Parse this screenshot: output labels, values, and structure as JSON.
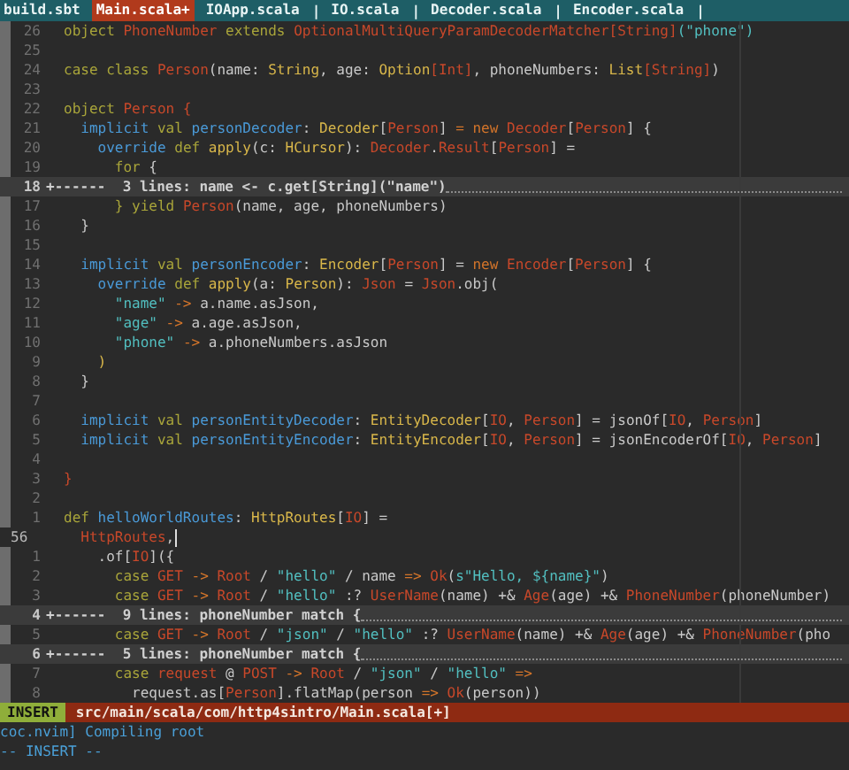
{
  "tabs": [
    {
      "label": "build.sbt",
      "selected": false
    },
    {
      "label": "Main.scala+",
      "selected": true
    },
    {
      "label": "IOApp.scala",
      "selected": false,
      "separator": "|"
    },
    {
      "label": "IO.scala",
      "selected": false,
      "separator": "|"
    },
    {
      "label": "Decoder.scala",
      "selected": false,
      "separator": "|"
    },
    {
      "label": "Encoder.scala",
      "selected": false,
      "separator": "|"
    }
  ],
  "lines": [
    {
      "kind": "code",
      "number": "26",
      "current": false,
      "tokens": [
        {
          "kind": "keyword",
          "text": "object "
        },
        {
          "kind": "name",
          "text": "PhoneNumber"
        },
        {
          "kind": "keyword",
          "text": " extends "
        },
        {
          "kind": "name",
          "text": "OptionalMultiQueryParamDecoderMatcher[String]"
        },
        {
          "kind": "string",
          "text": "(\"phone\")"
        }
      ]
    },
    {
      "kind": "code",
      "number": "25",
      "current": false
    },
    {
      "kind": "code",
      "number": "24",
      "current": false,
      "tokens": [
        {
          "kind": "keyword",
          "text": "case class "
        },
        {
          "kind": "name",
          "text": "Person"
        },
        {
          "kind": "plain",
          "text": "(name: "
        },
        {
          "kind": "type",
          "text": "String"
        },
        {
          "kind": "plain",
          "text": ", age: "
        },
        {
          "kind": "type",
          "text": "Option"
        },
        {
          "kind": "name",
          "text": "[Int]"
        },
        {
          "kind": "plain",
          "text": ", phoneNumbers: "
        },
        {
          "kind": "type",
          "text": "List"
        },
        {
          "kind": "name",
          "text": "[String]"
        },
        {
          "kind": "plain",
          "text": ")"
        }
      ]
    },
    {
      "kind": "code",
      "number": "23",
      "current": false
    },
    {
      "kind": "code",
      "number": "22",
      "current": false,
      "tokens": [
        {
          "kind": "keyword",
          "text": "object "
        },
        {
          "kind": "name",
          "text": "Person {"
        }
      ]
    },
    {
      "kind": "code",
      "number": "21",
      "current": false,
      "tokens": [
        {
          "kind": "modifier",
          "text": "  implicit "
        },
        {
          "kind": "keyword",
          "text": "val "
        },
        {
          "kind": "modifier",
          "text": "personDecoder"
        },
        {
          "kind": "plain",
          "text": ": "
        },
        {
          "kind": "type",
          "text": "Decoder"
        },
        {
          "kind": "plain",
          "text": "["
        },
        {
          "kind": "name",
          "text": "Person"
        },
        {
          "kind": "plain",
          "text": "] "
        },
        {
          "kind": "operator",
          "text": "= new "
        },
        {
          "kind": "name",
          "text": "Decoder"
        },
        {
          "kind": "plain",
          "text": "["
        },
        {
          "kind": "name",
          "text": "Person"
        },
        {
          "kind": "plain",
          "text": "] {"
        }
      ]
    },
    {
      "kind": "code",
      "number": "20",
      "current": false,
      "tokens": [
        {
          "kind": "modifier",
          "text": "    override "
        },
        {
          "kind": "keyword",
          "text": "def "
        },
        {
          "kind": "type",
          "text": "apply"
        },
        {
          "kind": "plain",
          "text": "(c: "
        },
        {
          "kind": "type",
          "text": "HCursor"
        },
        {
          "kind": "plain",
          "text": "): "
        },
        {
          "kind": "name",
          "text": "Decoder"
        },
        {
          "kind": "plain",
          "text": "."
        },
        {
          "kind": "name",
          "text": "Result"
        },
        {
          "kind": "plain",
          "text": "["
        },
        {
          "kind": "name",
          "text": "Person"
        },
        {
          "kind": "plain",
          "text": "] ="
        }
      ]
    },
    {
      "kind": "code",
      "number": "19",
      "current": false,
      "tokens": [
        {
          "kind": "keyword",
          "text": "      for"
        },
        {
          "kind": "plain",
          "text": " {"
        }
      ]
    },
    {
      "kind": "fold",
      "number": "18",
      "current": false,
      "text": "+------  3 lines: name <- c.get[String](\"name\")"
    },
    {
      "kind": "code",
      "number": "17",
      "current": false,
      "tokens": [
        {
          "kind": "keyword",
          "text": "      } yield "
        },
        {
          "kind": "name",
          "text": "Person"
        },
        {
          "kind": "plain",
          "text": "(name, age, phoneNumbers)"
        }
      ]
    },
    {
      "kind": "code",
      "number": "16",
      "current": false,
      "tokens": [
        {
          "kind": "plain",
          "text": "  }"
        }
      ]
    },
    {
      "kind": "code",
      "number": "15",
      "current": false
    },
    {
      "kind": "code",
      "number": "14",
      "current": false,
      "tokens": [
        {
          "kind": "modifier",
          "text": "  implicit "
        },
        {
          "kind": "keyword",
          "text": "val "
        },
        {
          "kind": "modifier",
          "text": "personEncoder"
        },
        {
          "kind": "plain",
          "text": ": "
        },
        {
          "kind": "type",
          "text": "Encoder"
        },
        {
          "kind": "plain",
          "text": "["
        },
        {
          "kind": "name",
          "text": "Person"
        },
        {
          "kind": "plain",
          "text": "] = "
        },
        {
          "kind": "operator",
          "text": "new "
        },
        {
          "kind": "name",
          "text": "Encoder"
        },
        {
          "kind": "plain",
          "text": "["
        },
        {
          "kind": "name",
          "text": "Person"
        },
        {
          "kind": "plain",
          "text": "] {"
        }
      ]
    },
    {
      "kind": "code",
      "number": "13",
      "current": false,
      "tokens": [
        {
          "kind": "modifier",
          "text": "    override "
        },
        {
          "kind": "keyword",
          "text": "def "
        },
        {
          "kind": "type",
          "text": "apply"
        },
        {
          "kind": "plain",
          "text": "(a: "
        },
        {
          "kind": "type",
          "text": "Person"
        },
        {
          "kind": "plain",
          "text": "): "
        },
        {
          "kind": "name",
          "text": "Json"
        },
        {
          "kind": "plain",
          "text": " = "
        },
        {
          "kind": "name",
          "text": "Json"
        },
        {
          "kind": "plain",
          "text": ".obj("
        }
      ]
    },
    {
      "kind": "code",
      "number": "12",
      "current": false,
      "tokens": [
        {
          "kind": "string",
          "text": "      \"name\""
        },
        {
          "kind": "operator",
          "text": " -> "
        },
        {
          "kind": "plain",
          "text": "a.name.asJson,"
        }
      ]
    },
    {
      "kind": "code",
      "number": "11",
      "current": false,
      "tokens": [
        {
          "kind": "string",
          "text": "      \"age\""
        },
        {
          "kind": "operator",
          "text": " -> "
        },
        {
          "kind": "plain",
          "text": "a.age.asJson,"
        }
      ]
    },
    {
      "kind": "code",
      "number": "10",
      "current": false,
      "tokens": [
        {
          "kind": "string",
          "text": "      \"phone\""
        },
        {
          "kind": "operator",
          "text": " -> "
        },
        {
          "kind": "plain",
          "text": "a.phoneNumbers.asJson"
        }
      ]
    },
    {
      "kind": "code",
      "number": "9",
      "current": false,
      "tokens": [
        {
          "kind": "type",
          "text": "    )"
        }
      ]
    },
    {
      "kind": "code",
      "number": "8",
      "current": false,
      "tokens": [
        {
          "kind": "plain",
          "text": "  }"
        }
      ]
    },
    {
      "kind": "code",
      "number": "7",
      "current": false
    },
    {
      "kind": "code",
      "number": "6",
      "current": false,
      "tokens": [
        {
          "kind": "modifier",
          "text": "  implicit "
        },
        {
          "kind": "keyword",
          "text": "val "
        },
        {
          "kind": "modifier",
          "text": "personEntityDecoder"
        },
        {
          "kind": "plain",
          "text": ": "
        },
        {
          "kind": "type",
          "text": "EntityDecoder"
        },
        {
          "kind": "plain",
          "text": "["
        },
        {
          "kind": "name",
          "text": "IO"
        },
        {
          "kind": "plain",
          "text": ", "
        },
        {
          "kind": "name",
          "text": "Person"
        },
        {
          "kind": "plain",
          "text": "] = jsonOf["
        },
        {
          "kind": "name",
          "text": "IO"
        },
        {
          "kind": "plain",
          "text": ", "
        },
        {
          "kind": "name",
          "text": "Person"
        },
        {
          "kind": "plain",
          "text": "]"
        }
      ]
    },
    {
      "kind": "code",
      "number": "5",
      "current": false,
      "tokens": [
        {
          "kind": "modifier",
          "text": "  implicit "
        },
        {
          "kind": "keyword",
          "text": "val "
        },
        {
          "kind": "modifier",
          "text": "personEntityEncoder"
        },
        {
          "kind": "plain",
          "text": ": "
        },
        {
          "kind": "type",
          "text": "EntityEncoder"
        },
        {
          "kind": "plain",
          "text": "["
        },
        {
          "kind": "name",
          "text": "IO"
        },
        {
          "kind": "plain",
          "text": ", "
        },
        {
          "kind": "name",
          "text": "Person"
        },
        {
          "kind": "plain",
          "text": "] = jsonEncoderOf["
        },
        {
          "kind": "name",
          "text": "IO"
        },
        {
          "kind": "plain",
          "text": ", "
        },
        {
          "kind": "name",
          "text": "Person"
        },
        {
          "kind": "plain",
          "text": "]"
        }
      ]
    },
    {
      "kind": "code",
      "number": "4",
      "current": false
    },
    {
      "kind": "code",
      "number": "3",
      "current": false,
      "tokens": [
        {
          "kind": "name",
          "text": "}"
        }
      ]
    },
    {
      "kind": "code",
      "number": "2",
      "current": false
    },
    {
      "kind": "code",
      "number": "1",
      "current": false,
      "tokens": [
        {
          "kind": "keyword",
          "text": "def "
        },
        {
          "kind": "modifier",
          "text": "helloWorldRoutes"
        },
        {
          "kind": "plain",
          "text": ": "
        },
        {
          "kind": "type",
          "text": "HttpRoutes"
        },
        {
          "kind": "plain",
          "text": "["
        },
        {
          "kind": "name",
          "text": "IO"
        },
        {
          "kind": "plain",
          "text": "] ="
        }
      ]
    },
    {
      "kind": "code",
      "number": "56",
      "current": true,
      "tokens": [
        {
          "kind": "name",
          "text": "  HttpRoutes"
        },
        {
          "kind": "plain",
          "text": ","
        }
      ]
    },
    {
      "kind": "code",
      "number": "1",
      "current": false,
      "tokens": [
        {
          "kind": "plain",
          "text": "    .of["
        },
        {
          "kind": "name",
          "text": "IO"
        },
        {
          "kind": "plain",
          "text": "]({"
        }
      ]
    },
    {
      "kind": "code",
      "number": "2",
      "current": false,
      "tokens": [
        {
          "kind": "keyword",
          "text": "      case "
        },
        {
          "kind": "name",
          "text": "GET"
        },
        {
          "kind": "operator",
          "text": " -> "
        },
        {
          "kind": "name",
          "text": "Root"
        },
        {
          "kind": "plain",
          "text": " / "
        },
        {
          "kind": "string",
          "text": "\"hello\""
        },
        {
          "kind": "plain",
          "text": " / name "
        },
        {
          "kind": "operator",
          "text": "=> "
        },
        {
          "kind": "name",
          "text": "Ok"
        },
        {
          "kind": "plain",
          "text": "("
        },
        {
          "kind": "string",
          "text": "s\"Hello, ${name}\""
        },
        {
          "kind": "plain",
          "text": ")"
        }
      ]
    },
    {
      "kind": "code",
      "number": "3",
      "current": false,
      "tokens": [
        {
          "kind": "keyword",
          "text": "      case "
        },
        {
          "kind": "name",
          "text": "GET"
        },
        {
          "kind": "operator",
          "text": " -> "
        },
        {
          "kind": "name",
          "text": "Root"
        },
        {
          "kind": "plain",
          "text": " / "
        },
        {
          "kind": "string",
          "text": "\"hello\""
        },
        {
          "kind": "plain",
          "text": " :? "
        },
        {
          "kind": "name",
          "text": "UserName"
        },
        {
          "kind": "plain",
          "text": "(name) +& "
        },
        {
          "kind": "name",
          "text": "Age"
        },
        {
          "kind": "plain",
          "text": "(age) +& "
        },
        {
          "kind": "name",
          "text": "PhoneNumber"
        },
        {
          "kind": "plain",
          "text": "(phoneNumber)"
        }
      ]
    },
    {
      "kind": "fold",
      "number": "4",
      "current": false,
      "text": "+------  9 lines: phoneNumber match {"
    },
    {
      "kind": "code",
      "number": "5",
      "current": false,
      "tokens": [
        {
          "kind": "keyword",
          "text": "      case "
        },
        {
          "kind": "name",
          "text": "GET"
        },
        {
          "kind": "operator",
          "text": " -> "
        },
        {
          "kind": "name",
          "text": "Root"
        },
        {
          "kind": "plain",
          "text": " / "
        },
        {
          "kind": "string",
          "text": "\"json\""
        },
        {
          "kind": "plain",
          "text": " / "
        },
        {
          "kind": "string",
          "text": "\"hello\""
        },
        {
          "kind": "plain",
          "text": " :? "
        },
        {
          "kind": "name",
          "text": "UserName"
        },
        {
          "kind": "plain",
          "text": "(name) +& "
        },
        {
          "kind": "name",
          "text": "Age"
        },
        {
          "kind": "plain",
          "text": "(age) +& "
        },
        {
          "kind": "name",
          "text": "PhoneNumber"
        },
        {
          "kind": "plain",
          "text": "(pho"
        }
      ]
    },
    {
      "kind": "fold",
      "number": "6",
      "current": false,
      "text": "+------  5 lines: phoneNumber match {"
    },
    {
      "kind": "code",
      "number": "7",
      "current": false,
      "tokens": [
        {
          "kind": "keyword",
          "text": "      case "
        },
        {
          "kind": "name",
          "text": "request"
        },
        {
          "kind": "plain",
          "text": " @ "
        },
        {
          "kind": "name",
          "text": "POST"
        },
        {
          "kind": "operator",
          "text": " -> "
        },
        {
          "kind": "name",
          "text": "Root"
        },
        {
          "kind": "plain",
          "text": " / "
        },
        {
          "kind": "string",
          "text": "\"json\""
        },
        {
          "kind": "plain",
          "text": " / "
        },
        {
          "kind": "string",
          "text": "\"hello\""
        },
        {
          "kind": "operator",
          "text": " =>"
        }
      ]
    },
    {
      "kind": "code",
      "number": "8",
      "current": false,
      "tokens": [
        {
          "kind": "plain",
          "text": "        request.as["
        },
        {
          "kind": "name",
          "text": "Person"
        },
        {
          "kind": "plain",
          "text": "].flatMap(person "
        },
        {
          "kind": "operator",
          "text": "=> "
        },
        {
          "kind": "name",
          "text": "Ok"
        },
        {
          "kind": "plain",
          "text": "(person))"
        }
      ]
    }
  ],
  "status_bar": {
    "mode": "INSERT",
    "file": "src/main/scala/com/http4sintro/Main.scala[+]"
  },
  "messages": [
    "coc.nvim] Compiling root",
    "-- INSERT --"
  ]
}
